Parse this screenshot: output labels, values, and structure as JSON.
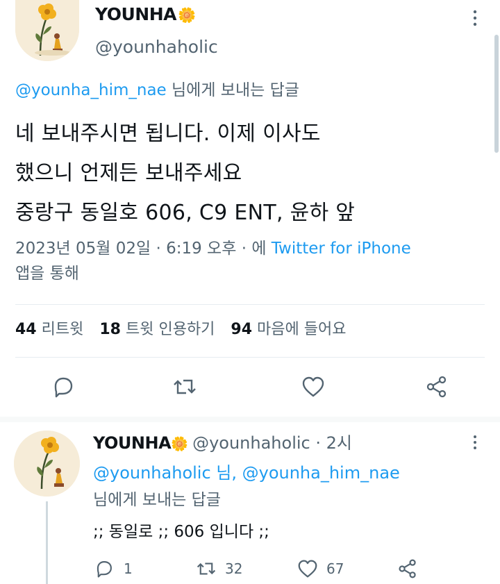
{
  "main_tweet": {
    "display_name": "YOUNHA",
    "name_emoji": "🌼",
    "handle": "@younhaholic",
    "reply_to_handle": "@younha_him_nae",
    "reply_to_suffix": " 님에게 보내는 답글",
    "text_lines": [
      "네 보내주시면 됩니다. 이제 이사도",
      "했으니 언제든 보내주세요",
      "중랑구 동일호 606, C9 ENT, 윤하 앞"
    ],
    "timestamp": "2023년 05월 02일 · 6:19 오후 · 에",
    "source_app": "Twitter for iPhone",
    "source_suffix": "앱을 통해",
    "stats": {
      "retweets_count": "44",
      "retweets_label": "리트윗",
      "quotes_count": "18",
      "quotes_label": "트윗 인용하기",
      "likes_count": "94",
      "likes_label": "마음에 들어요"
    }
  },
  "reply_tweet": {
    "display_name": "YOUNHA",
    "name_emoji": "🌼",
    "handle_time": "@younhaholic · 2시",
    "mentions": "@younhaholic 님, @younha_him_nae",
    "reply_label": "님에게 보내는 답글",
    "text": ";; 동일로 ;; 606 입니다 ;;",
    "reply_count": "1",
    "retweet_count": "32",
    "like_count": "67"
  },
  "colors": {
    "accent": "#1d9bf0",
    "muted": "#536471",
    "text": "#0f1419",
    "divider": "#e6ecf0"
  },
  "icons": [
    "more-vertical-icon",
    "reply-icon",
    "retweet-icon",
    "like-icon",
    "share-icon",
    "flower-emoji-icon",
    "avatar-flower-icon"
  ]
}
